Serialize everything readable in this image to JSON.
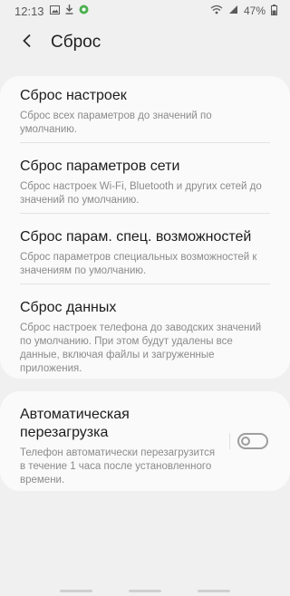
{
  "status_bar": {
    "time": "12:13",
    "battery_percent": "47%",
    "icons": [
      "image-icon",
      "download-icon",
      "app-notification-icon",
      "wifi-icon",
      "signal-icon",
      "battery-icon"
    ]
  },
  "header": {
    "title": "Сброс",
    "back_icon": "back-arrow-icon"
  },
  "reset_options": [
    {
      "title": "Сброс настроек",
      "description": "Сброс всех параметров до значений по умолчанию."
    },
    {
      "title": "Сброс параметров сети",
      "description": "Сброс настроек Wi-Fi, Bluetooth и других сетей до значений по умолчанию."
    },
    {
      "title": "Сброс парам. спец. возможностей",
      "description": "Сброс параметров специальных возможностей к значениям по умолчанию."
    },
    {
      "title": "Сброс данных",
      "description": "Сброс настроек телефона до заводских значений по умолчанию. При этом будут удалены все данные, включая файлы и загруженные приложения."
    }
  ],
  "auto_restart": {
    "title": "Автоматическая перезагрузка",
    "description": "Телефон автоматически перезагрузится в течение 1 часа после установленного времени.",
    "enabled": false
  },
  "colors": {
    "background": "#f0f0f0",
    "card": "#fafafa",
    "toggle_off": "#9e9e9e"
  }
}
